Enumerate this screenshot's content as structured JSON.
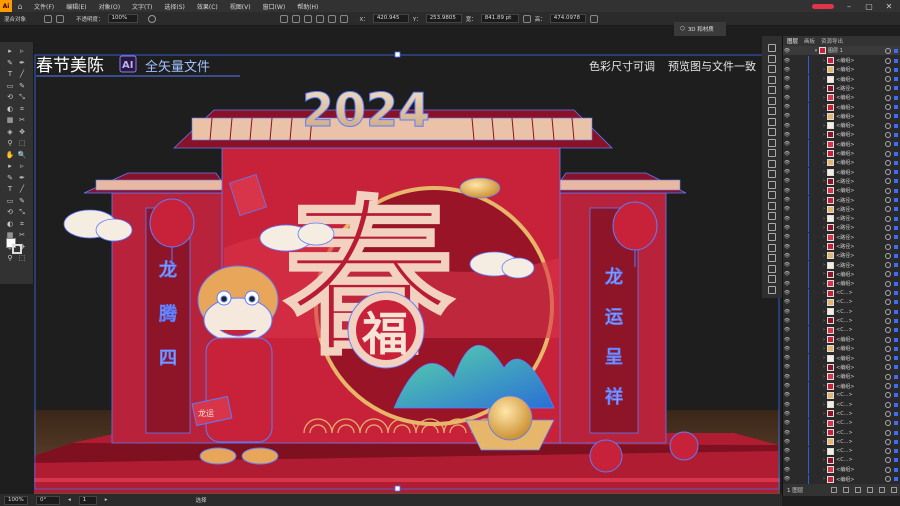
{
  "app": {
    "logo": "Ai"
  },
  "menu": [
    "文件(F)",
    "编辑(E)",
    "对象(O)",
    "文字(T)",
    "选择(S)",
    "效果(C)",
    "视图(V)",
    "窗口(W)",
    "帮助(H)"
  ],
  "control": {
    "selection_label": "混合对象",
    "opacity_label": "不透明度：",
    "opacity_value": "100%",
    "x_label": "X：",
    "x_value": "420.945",
    "y_label": "Y：",
    "y_value": "253.9805",
    "w_label": "宽：",
    "w_value": "841.89 pt",
    "h_label": "高：",
    "h_value": "474.0978"
  },
  "tab3d": "3D 和材质",
  "artwork": {
    "title": "春节美陈",
    "ai_badge": "AI",
    "vector_label": "全矢量文件",
    "right_note_1": "色彩尺寸可调",
    "right_note_2": "预览图与文件一致",
    "year": "2024",
    "big_char": "春",
    "fu_char": "福",
    "left_couplet": [
      "龙",
      "腾",
      "四"
    ],
    "right_couplet": [
      "龙",
      "运",
      "呈",
      "祥"
    ],
    "dragon_scroll": "龙运",
    "colors": {
      "red": "#c8223a",
      "dark_red": "#7e1020",
      "gold": "#e6b66a",
      "blue_outline": "#5b7cff"
    }
  },
  "layers": {
    "tabs": [
      "图层",
      "画板",
      "资源导出"
    ],
    "top_layer": "图层 1",
    "rows": [
      "<编组>",
      "<编组>",
      "<编组>",
      "<路径>",
      "<编组>",
      "<编组>",
      "<编组>",
      "<编组>",
      "<编组>",
      "<编组>",
      "<编组>",
      "<编组>",
      "<编组>",
      "<路径>",
      "<编组>",
      "<路径>",
      "<路径>",
      "<路径>",
      "<路径>",
      "<路径>",
      "<路径>",
      "<路径>",
      "<路径>",
      "<编组>",
      "<编组>",
      "<C...>",
      "<C...>",
      "<C...>",
      "<C...>",
      "<C...>",
      "<编组>",
      "<编组>",
      "<编组>",
      "<编组>",
      "<编组>",
      "<编组>",
      "<C...>",
      "<C...>",
      "<C...>",
      "<C...>",
      "<C...>",
      "<C...>",
      "<C...>",
      "<C...>",
      "<编组>",
      "<编组>"
    ],
    "bottom_label": "1 图层"
  },
  "status": {
    "zoom": "100%",
    "rotate": "0°",
    "page": "1",
    "tool": "选择"
  }
}
